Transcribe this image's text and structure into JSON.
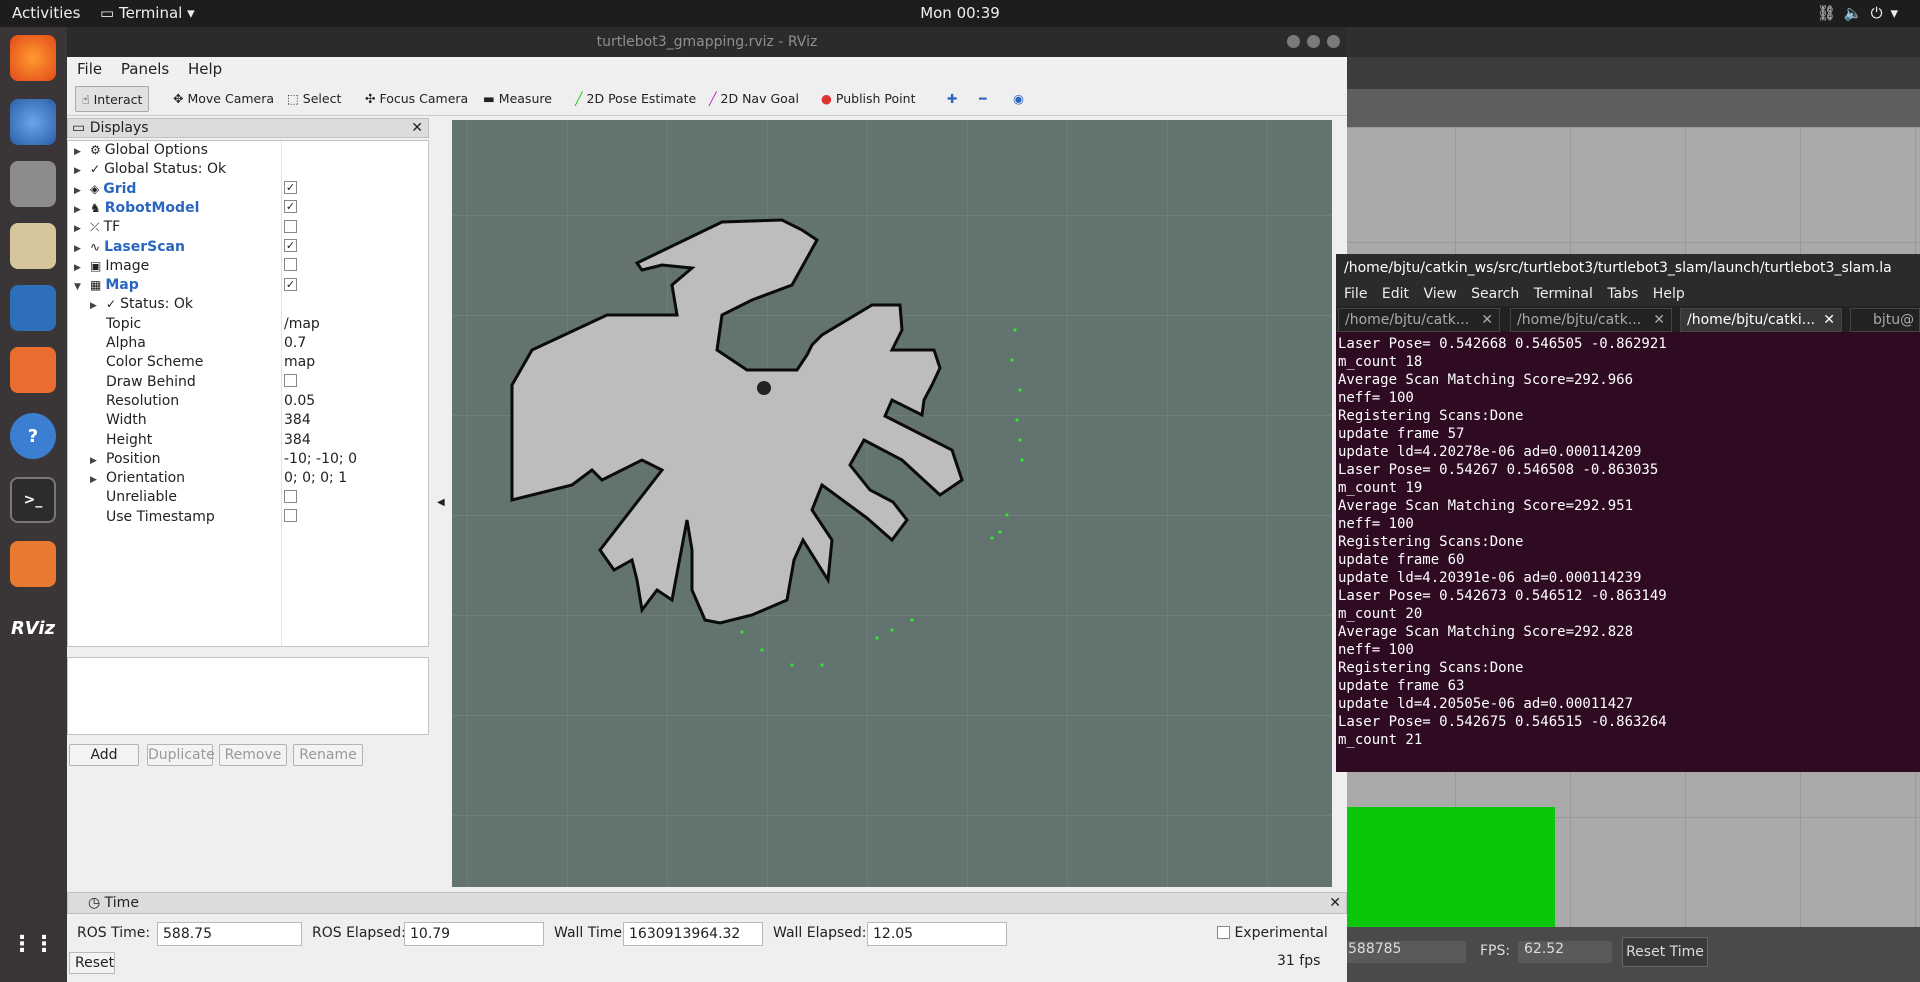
{
  "topbar": {
    "activities": "Activities",
    "app_menu": "Terminal",
    "clock": "Mon 00:39"
  },
  "dock": {
    "items": [
      "firefox-icon",
      "thunderbird-icon",
      "files-icon",
      "rhythmbox-icon",
      "writer-icon",
      "software-icon",
      "help-icon",
      "terminal-icon",
      "gazebo-icon",
      "rviz-icon"
    ],
    "rviz_label": "RViz"
  },
  "rviz": {
    "title": "turtlebot3_gmapping.rviz - RViz",
    "menu": [
      "File",
      "Panels",
      "Help"
    ],
    "tools": [
      "Interact",
      "Move Camera",
      "Select",
      "Focus Camera",
      "Measure",
      "2D Pose Estimate",
      "2D Nav Goal",
      "Publish Point"
    ],
    "displays_title": "Displays",
    "tree": [
      {
        "label": "Global Options",
        "value": "",
        "blue": false
      },
      {
        "label": "Global Status: Ok",
        "value": "",
        "blue": false
      },
      {
        "label": "Grid",
        "value": "checked",
        "blue": true
      },
      {
        "label": "RobotModel",
        "value": "checked",
        "blue": true
      },
      {
        "label": "TF",
        "value": "unchecked",
        "blue": false
      },
      {
        "label": "LaserScan",
        "value": "checked",
        "blue": true
      },
      {
        "label": "Image",
        "value": "unchecked",
        "blue": false
      },
      {
        "label": "Map",
        "value": "checked",
        "blue": true
      }
    ],
    "map_props": [
      {
        "label": "Status: Ok",
        "value": ""
      },
      {
        "label": "Topic",
        "value": "/map"
      },
      {
        "label": "Alpha",
        "value": "0.7"
      },
      {
        "label": "Color Scheme",
        "value": "map"
      },
      {
        "label": "Draw Behind",
        "value": "unchecked"
      },
      {
        "label": "Resolution",
        "value": "0.05"
      },
      {
        "label": "Width",
        "value": "384"
      },
      {
        "label": "Height",
        "value": "384"
      },
      {
        "label": "Position",
        "value": "-10; -10; 0"
      },
      {
        "label": "Orientation",
        "value": "0; 0; 0; 1"
      },
      {
        "label": "Unreliable",
        "value": "unchecked"
      },
      {
        "label": "Use Timestamp",
        "value": "unchecked"
      }
    ],
    "buttons": {
      "add": "Add",
      "duplicate": "Duplicate",
      "remove": "Remove",
      "rename": "Rename"
    },
    "time": {
      "title": "Time",
      "ros_time_label": "ROS Time:",
      "ros_time": "588.75",
      "ros_elapsed_label": "ROS Elapsed:",
      "ros_elapsed": "10.79",
      "wall_time_label": "Wall Time:",
      "wall_time": "1630913964.32",
      "wall_elapsed_label": "Wall Elapsed:",
      "wall_elapsed": "12.05",
      "experimental": "Experimental",
      "reset": "Reset",
      "fps": "31 fps"
    }
  },
  "gazebo": {
    "sim_time": "588785",
    "fps_label": "FPS:",
    "fps": "62.52",
    "reset_time": "Reset Time"
  },
  "terminal": {
    "title": "/home/bjtu/catkin_ws/src/turtlebot3/turtlebot3_slam/launch/turtlebot3_slam.la",
    "menu": [
      "File",
      "Edit",
      "View",
      "Search",
      "Terminal",
      "Tabs",
      "Help"
    ],
    "tabs": [
      "/home/bjtu/catk...",
      "/home/bjtu/catk...",
      "/home/bjtu/catki...",
      "bjtu@"
    ],
    "lines": [
      "Laser Pose= 0.542668 0.546505 -0.862921",
      "m_count 18",
      "Average Scan Matching Score=292.966",
      "neff= 100",
      "Registering Scans:Done",
      "update frame 57",
      "update ld=4.20278e-06 ad=0.000114209",
      "Laser Pose= 0.54267 0.546508 -0.863035",
      "m_count 19",
      "Average Scan Matching Score=292.951",
      "neff= 100",
      "Registering Scans:Done",
      "update frame 60",
      "update ld=4.20391e-06 ad=0.000114239",
      "Laser Pose= 0.542673 0.546512 -0.863149",
      "m_count 20",
      "Average Scan Matching Score=292.828",
      "neff= 100",
      "Registering Scans:Done",
      "update frame 63",
      "update ld=4.20505e-06 ad=0.00011427",
      "Laser Pose= 0.542675 0.546515 -0.863264",
      "m_count 21"
    ]
  }
}
